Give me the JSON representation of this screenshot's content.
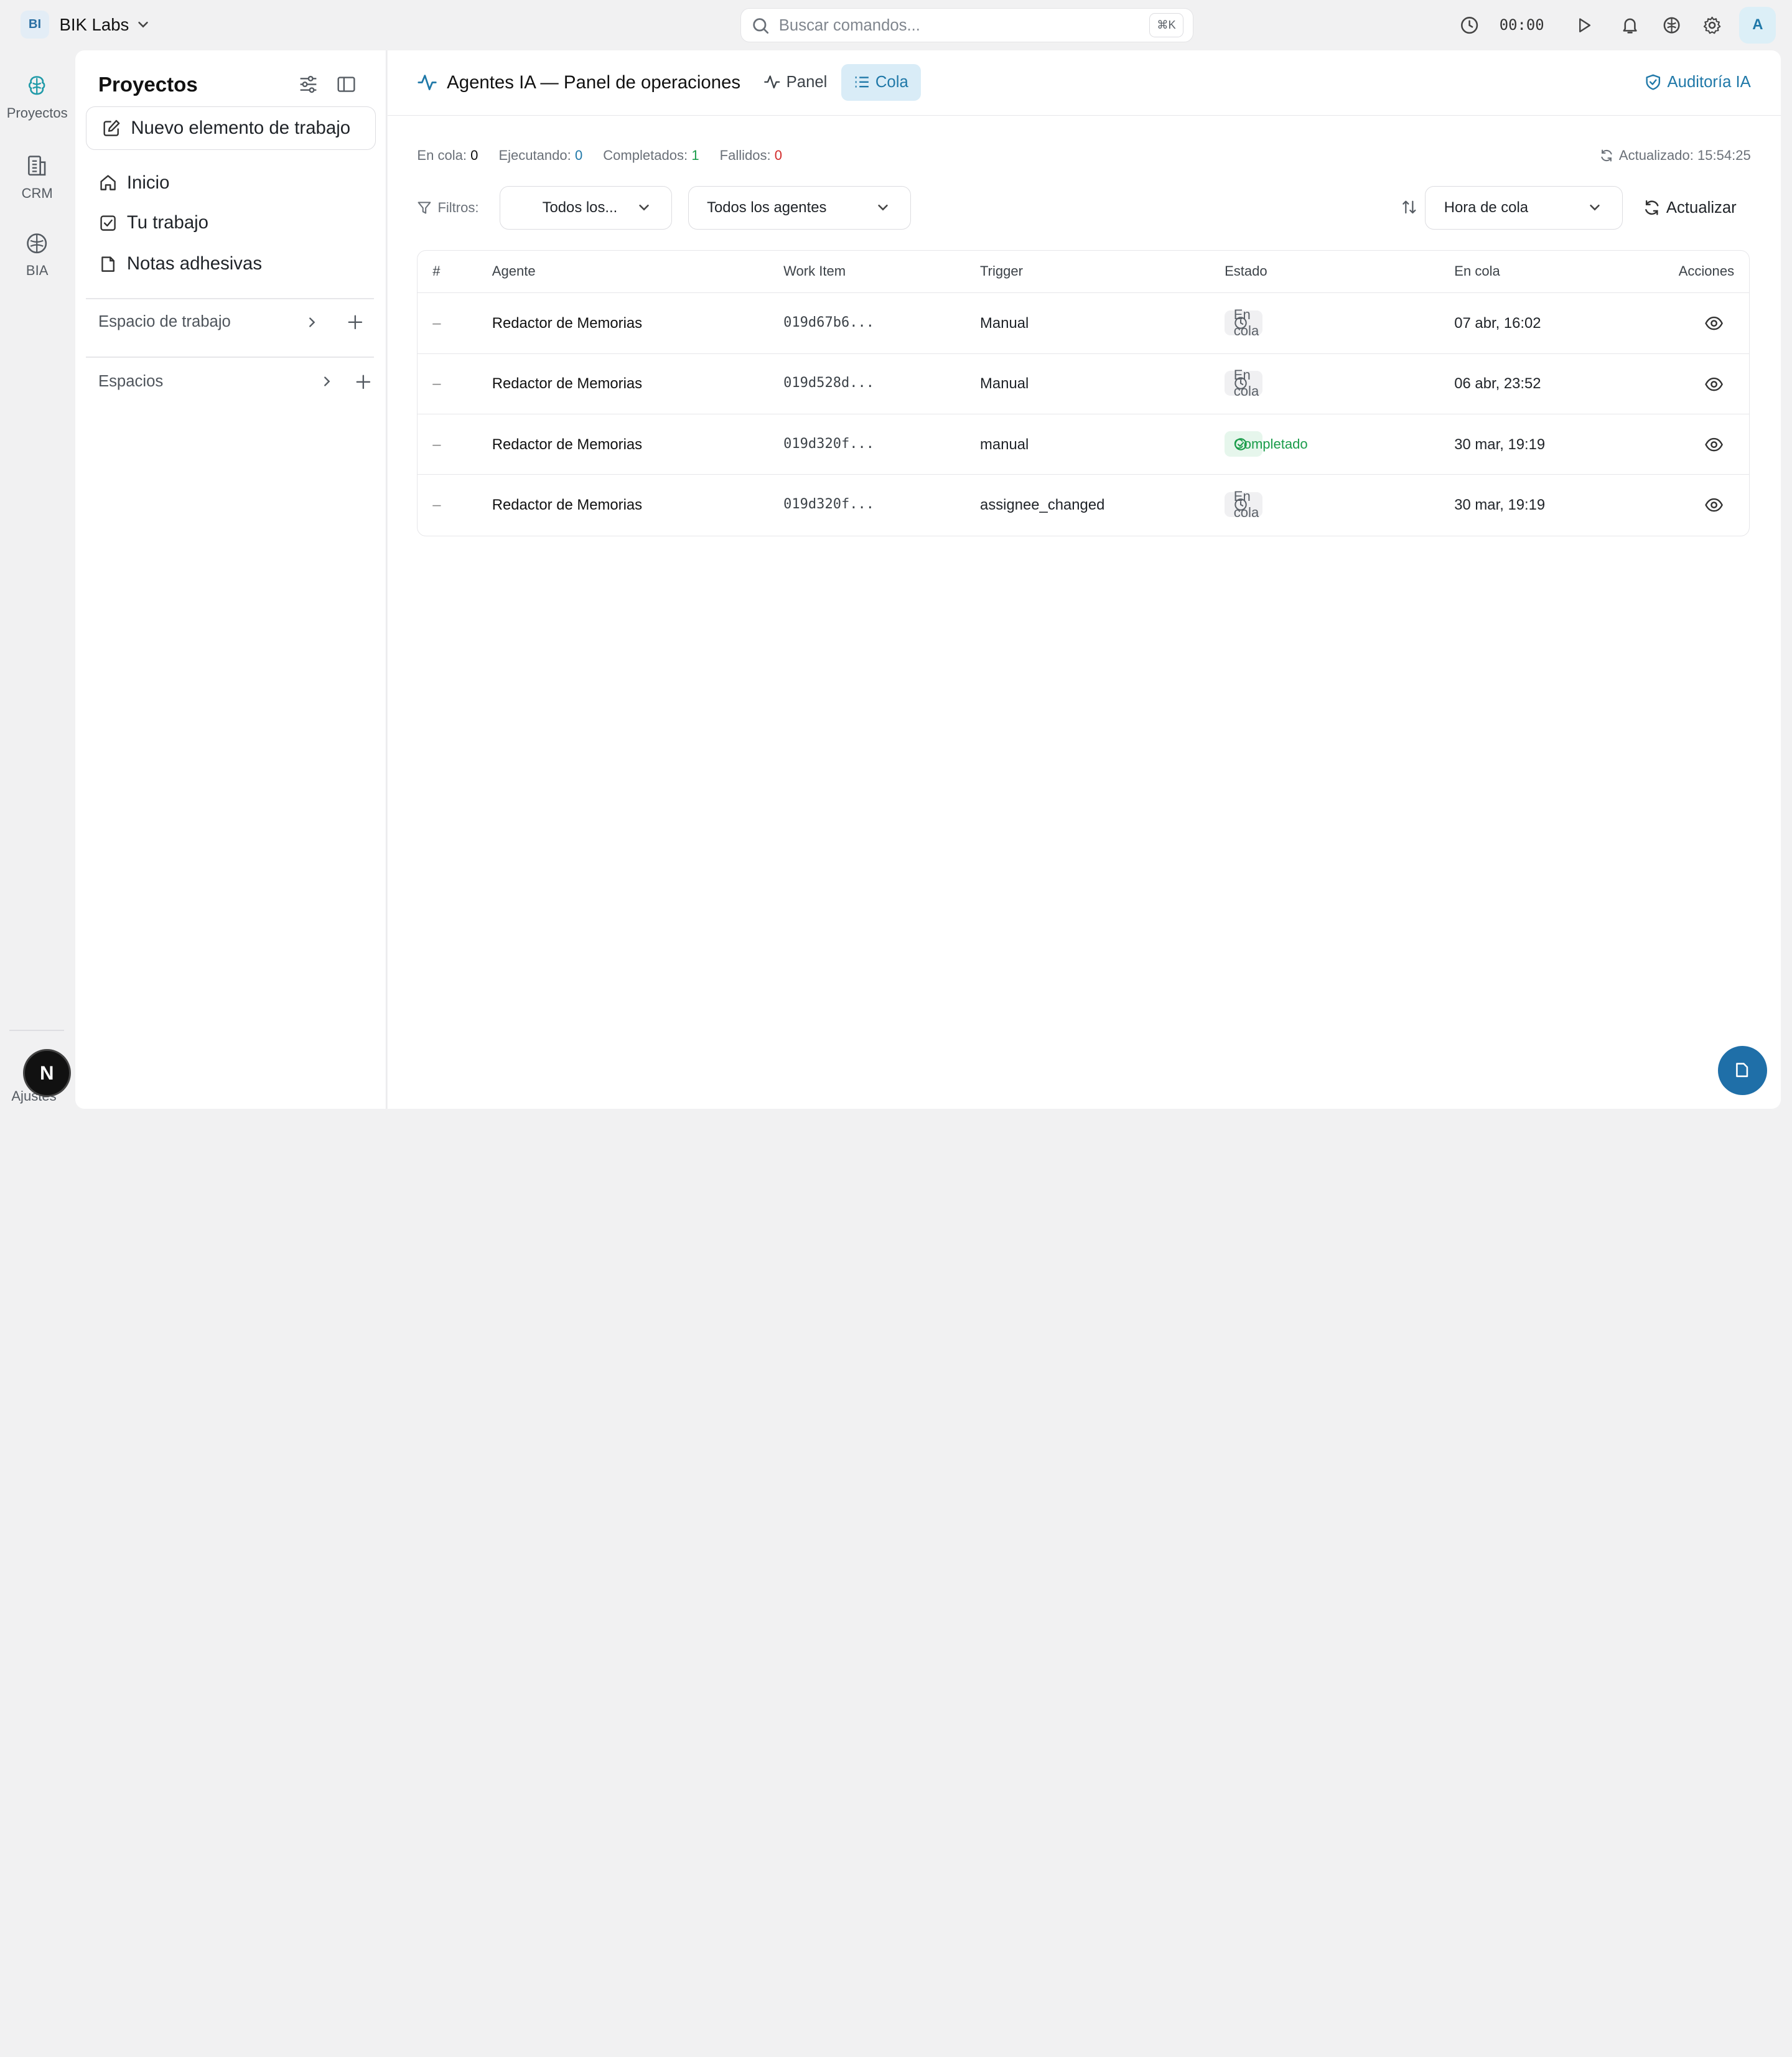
{
  "topbar": {
    "workspace_initials": "BI",
    "workspace_name": "BIK Labs",
    "search_placeholder": "Buscar comandos...",
    "search_shortcut": "⌘K",
    "timer": "00:00",
    "avatar_initial": "A"
  },
  "rail": {
    "items": [
      {
        "label": "Proyectos",
        "icon": "brain-icon"
      },
      {
        "label": "CRM",
        "icon": "building-icon"
      },
      {
        "label": "BIA",
        "icon": "brain-outline-icon"
      }
    ],
    "user_badge": "N",
    "settings_label": "Ajustes"
  },
  "sidebar": {
    "title": "Proyectos",
    "new_item_label": "Nuevo elemento de trabajo",
    "nav": [
      {
        "label": "Inicio",
        "icon": "home-icon"
      },
      {
        "label": "Tu trabajo",
        "icon": "checkbox-icon"
      },
      {
        "label": "Notas adhesivas",
        "icon": "note-icon"
      }
    ],
    "sections": [
      {
        "label": "Espacio de trabajo"
      },
      {
        "label": "Espacios"
      }
    ]
  },
  "main": {
    "title": "Agentes IA — Panel de operaciones",
    "tabs": [
      {
        "label": "Panel",
        "active": false
      },
      {
        "label": "Cola",
        "active": true
      }
    ],
    "audit_label": "Auditoría IA",
    "stats": {
      "queued_label": "En cola:",
      "queued_value": "0",
      "running_label": "Ejecutando:",
      "running_value": "0",
      "completed_label": "Completados:",
      "completed_value": "1",
      "failed_label": "Fallidos:",
      "failed_value": "0"
    },
    "updated": "Actualizado: 15:54:25",
    "filters": {
      "label": "Filtros:",
      "status_value": "Todos los...",
      "agent_value": "Todos los agentes",
      "sort_value": "Hora de cola",
      "refresh_label": "Actualizar"
    },
    "table": {
      "headers": [
        "#",
        "Agente",
        "Work Item",
        "Trigger",
        "Estado",
        "En cola",
        "Acciones"
      ],
      "rows": [
        {
          "num": "–",
          "agent": "Redactor de Memorias",
          "work_item": "019d67b6...",
          "trigger": "Manual",
          "status": "En cola",
          "status_type": "queued",
          "queued_at": "07 abr, 16:02"
        },
        {
          "num": "–",
          "agent": "Redactor de Memorias",
          "work_item": "019d528d...",
          "trigger": "Manual",
          "status": "En cola",
          "status_type": "queued",
          "queued_at": "06 abr, 23:52"
        },
        {
          "num": "–",
          "agent": "Redactor de Memorias",
          "work_item": "019d320f...",
          "trigger": "manual",
          "status": "Completado",
          "status_type": "done",
          "queued_at": "30 mar, 19:19"
        },
        {
          "num": "–",
          "agent": "Redactor de Memorias",
          "work_item": "019d320f...",
          "trigger": "assignee_changed",
          "status": "En cola",
          "status_type": "queued",
          "queued_at": "30 mar, 19:19"
        }
      ]
    }
  },
  "colors": {
    "accent": "#1f78a8",
    "success": "#1a9c4a",
    "danger": "#d22a2a"
  }
}
